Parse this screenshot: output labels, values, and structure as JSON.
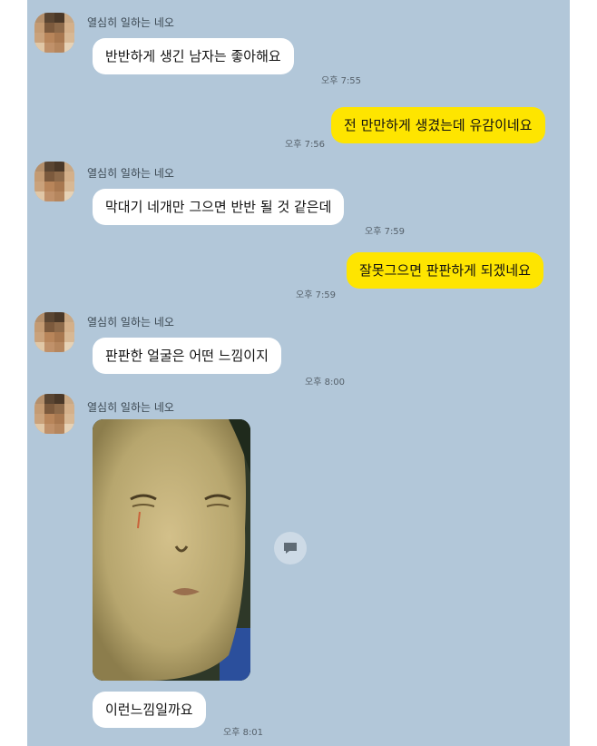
{
  "sender_name": "열심히 일하는 네오",
  "messages": [
    {
      "side": "in",
      "text": "반반하게 생긴 남자는 좋아해요",
      "time": "오후 7:55"
    },
    {
      "side": "out",
      "text": "전 만만하게 생겼는데 유감이네요",
      "time": "오후 7:56"
    },
    {
      "side": "in",
      "text": "막대기 네개만 그으면 반반 될 것 같은데",
      "time": "오후 7:59"
    },
    {
      "side": "out",
      "text": "잘못그으면 판판하게 되겠네요",
      "time": "오후 7:59"
    },
    {
      "side": "in",
      "text": "판판한 얼굴은 어떤 느낌이지",
      "time": "오후 8:00"
    },
    {
      "side": "in",
      "type": "image",
      "text": "이런느낌일까요",
      "time": "오후 8:01"
    }
  ],
  "icons": {
    "share": "speech-bubble-icon"
  },
  "colors": {
    "background": "#b2c7d9",
    "incoming_bubble": "#ffffff",
    "outgoing_bubble": "#fee500"
  }
}
